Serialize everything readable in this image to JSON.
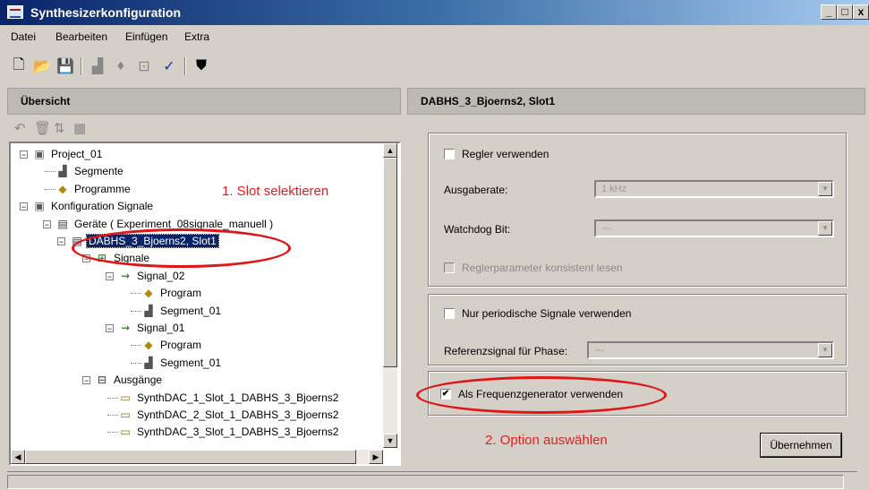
{
  "window": {
    "title": "Synthesizerkonfiguration",
    "controls": [
      "_",
      "□",
      "x"
    ]
  },
  "menu": [
    "Datei",
    "Bearbeiten",
    "Einfügen",
    "Extra"
  ],
  "toolbar": {
    "icons": [
      "new-icon",
      "open-icon",
      "save-icon",
      "chart-icon",
      "diamond-icon",
      "wave-icon",
      "check-icon",
      "compile-icon"
    ]
  },
  "left": {
    "header": "Übersicht",
    "tree": [
      {
        "label": "Project_01",
        "level": 0,
        "icon": "project-icon",
        "expander": "minus"
      },
      {
        "label": "Segmente",
        "level": 1,
        "icon": "segment-icon"
      },
      {
        "label": "Programme",
        "level": 1,
        "icon": "program-icon"
      },
      {
        "label": "Konfiguration Signale",
        "level": 0,
        "icon": "project-icon",
        "expander": "minus"
      },
      {
        "label": "Geräte ( Experiment_08signale_manuell )",
        "level": 1,
        "icon": "device-icon",
        "expander": "minus"
      },
      {
        "label": "DABHS_3_Bjoerns2, Slot1",
        "level": 2,
        "icon": "device-icon",
        "expander": "minus",
        "selected": true
      },
      {
        "label": "Signale",
        "level": 3,
        "icon": "signal-folder-icon",
        "expander": "minus"
      },
      {
        "label": "Signal_02",
        "level": 4,
        "icon": "signal-icon",
        "expander": "minus"
      },
      {
        "label": "Program",
        "level": 5,
        "icon": "program-icon"
      },
      {
        "label": "Segment_01",
        "level": 5,
        "icon": "segment-icon"
      },
      {
        "label": "Signal_01",
        "level": 4,
        "icon": "signal-icon",
        "expander": "minus"
      },
      {
        "label": "Program",
        "level": 5,
        "icon": "program-icon"
      },
      {
        "label": "Segment_01",
        "level": 5,
        "icon": "segment-icon"
      },
      {
        "label": "Ausgänge",
        "level": 3,
        "icon": "output-folder-icon",
        "expander": "minus"
      },
      {
        "label": "SynthDAC_1_Slot_1_DABHS_3_Bjoerns2",
        "level": 4,
        "icon": "output-icon"
      },
      {
        "label": "SynthDAC_2_Slot_1_DABHS_3_Bjoerns2",
        "level": 4,
        "icon": "output-icon"
      },
      {
        "label": "SynthDAC_3_Slot_1_DABHS_3_Bjoerns2",
        "level": 4,
        "icon": "output-icon"
      }
    ]
  },
  "right": {
    "header": "DABHS_3_Bjoerns2, Slot1",
    "regler_label": "Regler verwenden",
    "ausgaberate_label": "Ausgaberate:",
    "ausgaberate_value": "1 kHz",
    "watchdog_label": "Watchdog Bit:",
    "watchdog_value": "---",
    "reglerparameter_label": "Reglerparameter konsistent lesen",
    "periodisch_label": "Nur periodische Signale verwenden",
    "referenz_label": "Referenzsignal für Phase:",
    "referenz_value": "---",
    "frequenz_label": "Als Frequenzgenerator verwenden",
    "frequenz_checked": true,
    "apply_button": "Übernehmen"
  },
  "annotations": {
    "step1": "1. Slot selektieren",
    "step2": "2. Option auswählen",
    "color": "#e02020"
  }
}
